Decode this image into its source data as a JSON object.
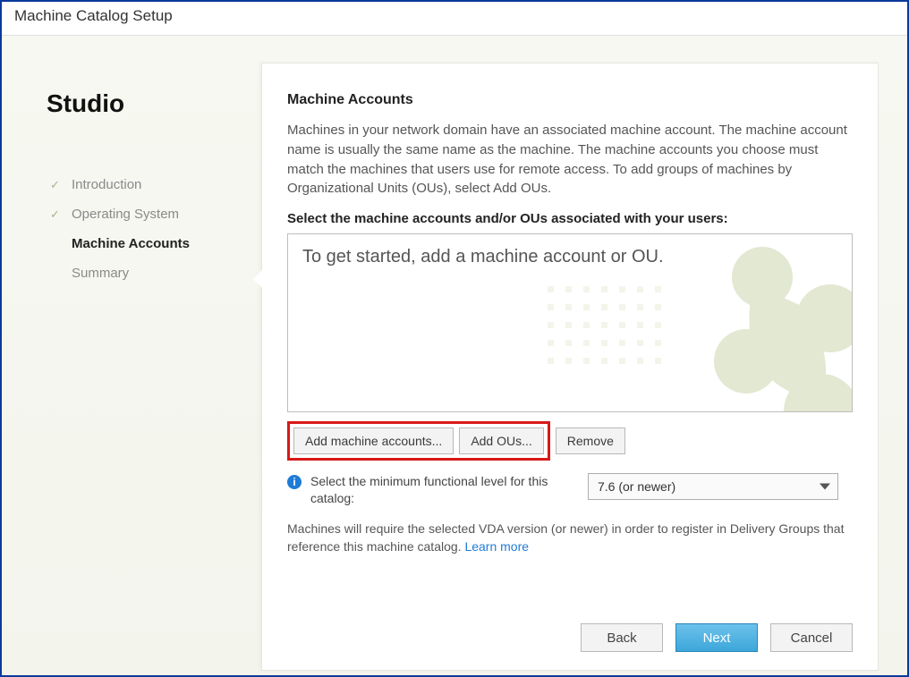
{
  "window": {
    "title": "Machine Catalog Setup"
  },
  "brand": "Studio",
  "steps": [
    {
      "label": "Introduction",
      "state": "done"
    },
    {
      "label": "Operating System",
      "state": "done"
    },
    {
      "label": "Machine Accounts",
      "state": "current"
    },
    {
      "label": "Summary",
      "state": "pending"
    }
  ],
  "main": {
    "heading": "Machine Accounts",
    "desc": "Machines in your network domain have an associated machine account. The machine account name is usually the same name as the machine. The machine accounts you choose must match the machines that users use for remote access. To add groups of machines by Organizational Units (OUs), select Add OUs.",
    "select_label": "Select the machine accounts and/or OUs associated with your users:",
    "list_placeholder": "To get started, add a machine account or OU.",
    "add_accounts_btn": "Add machine accounts...",
    "add_ous_btn": "Add OUs...",
    "remove_btn": "Remove",
    "functional_label": "Select the minimum functional level for this catalog:",
    "functional_value": "7.6 (or newer)",
    "vda_note_a": "Machines will require the selected VDA version (or newer) in order to register in Delivery Groups that reference this machine catalog. ",
    "learn_more": "Learn more"
  },
  "buttons": {
    "back": "Back",
    "next": "Next",
    "cancel": "Cancel"
  }
}
